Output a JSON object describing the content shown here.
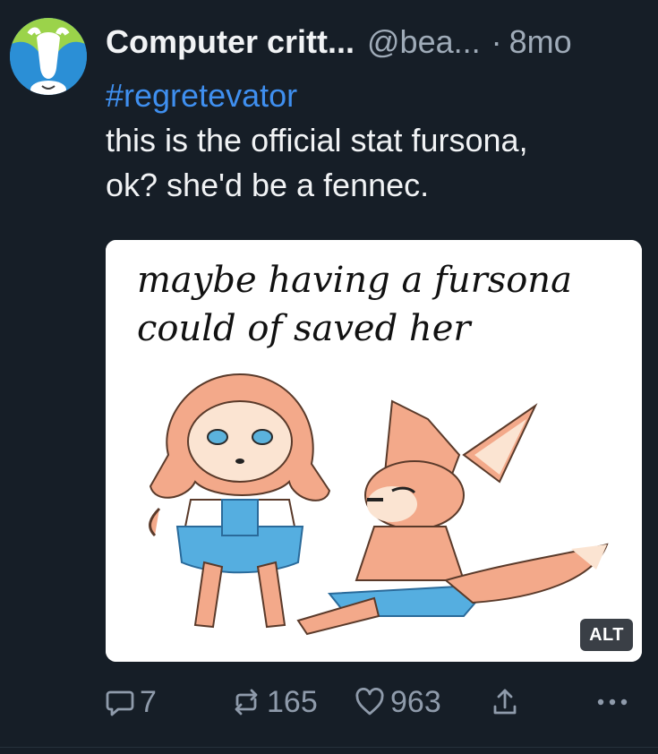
{
  "post": {
    "author_name": "Computer critt...",
    "author_handle": "@bea...",
    "separator": "·",
    "time": "8mo",
    "hashtag": "#regretevator",
    "text_lines": [
      "this is the official stat fursona,",
      "ok? she'd be a fennec."
    ]
  },
  "embed": {
    "image_caption_lines": [
      "maybe having a fursona",
      "could of saved her"
    ],
    "alt_label": "ALT"
  },
  "actions": {
    "replies": "7",
    "reposts": "165",
    "likes": "963"
  },
  "icons": {
    "reply": "speech-bubble-icon",
    "repost": "repost-arrows-icon",
    "like": "heart-icon",
    "share": "share-upload-icon",
    "more": "ellipsis-icon"
  },
  "colors": {
    "background": "#161e27",
    "hashtag": "#3f8fef",
    "muted": "#8f9bab",
    "alt_badge": "#3a3f46"
  }
}
